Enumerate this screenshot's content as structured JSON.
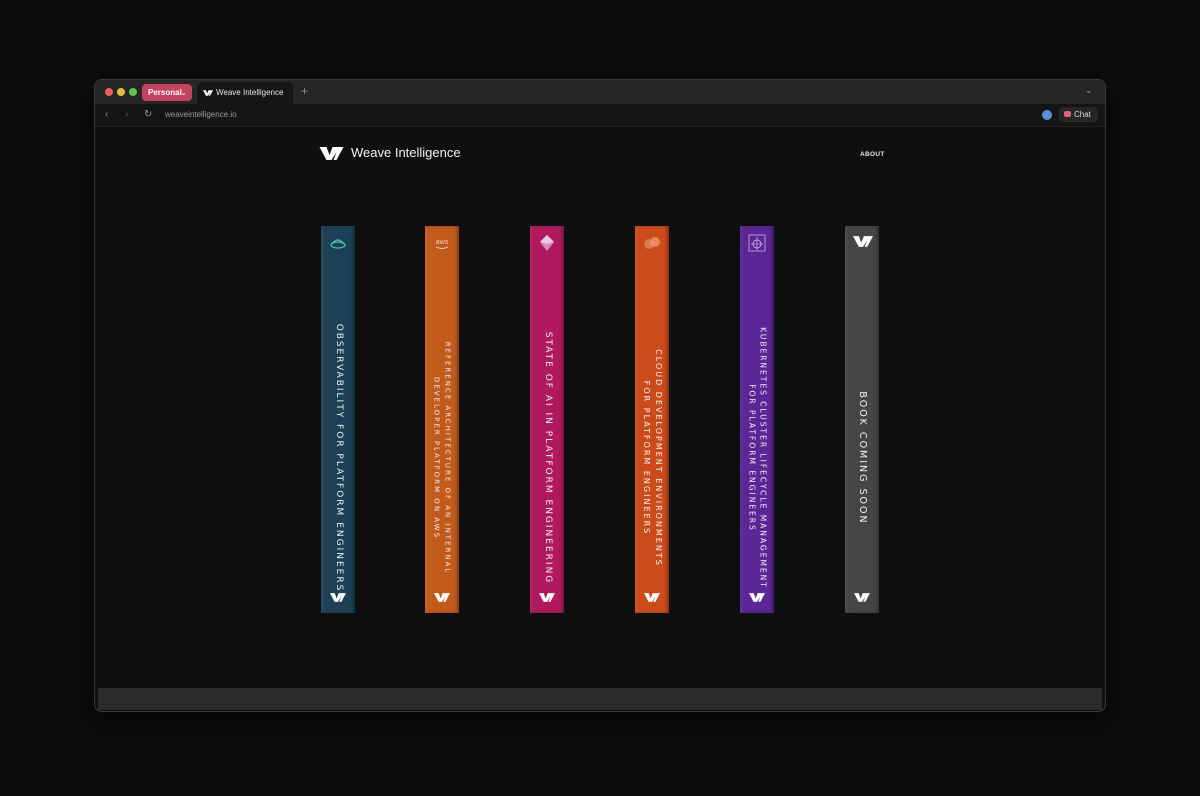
{
  "browser": {
    "profile_label": "Personal",
    "tab_title": "Weave Intelligence",
    "new_tab_symbol": "+",
    "url": "weaveintelligence.io",
    "chat_label": "Chat",
    "profile_color": "#c3425d"
  },
  "site": {
    "brand_name": "Weave Intelligence",
    "nav_about": "ABOUT"
  },
  "books": [
    {
      "title": "OBSERVABILITY FOR PLATFORM ENGINEERS",
      "lines": [
        "OBSERVABILITY FOR PLATFORM ENGINEERS"
      ],
      "color": "#1c4157",
      "icon": "bowl-icon"
    },
    {
      "title": "REFERENCE ARCHITECTURE OF AN INTERNAL DEVELOPER PLATFORM ON AWS",
      "lines": [
        "REFERENCE ARCHITECTURE OF AN INTERNAL",
        "DEVELOPER PLATFORM ON AWS"
      ],
      "color": "#c25a1c",
      "icon": "aws-icon"
    },
    {
      "title": "STATE OF AI IN PLATFORM ENGINEERING",
      "lines": [
        "STATE OF AI IN PLATFORM ENGINEERING"
      ],
      "color": "#b0195e",
      "icon": "crystal-icon"
    },
    {
      "title": "CLOUD DEVELOPMENT ENVIRONMENTS FOR PLATFORM ENGINEERS",
      "lines": [
        "CLOUD DEVELOPMENT ENVIRONMENTS",
        "FOR PLATFORM ENGINEERS"
      ],
      "color": "#cc4b1b",
      "icon": "cloud-icon"
    },
    {
      "title": "KUBERNETES CLUSTER LIFECYCLE MANAGEMENT FOR PLATFORM ENGINEERS",
      "lines": [
        "KUBERNETES CLUSTER LIFECYCLE MANAGEMENT",
        "FOR PLATFORM ENGINEERS"
      ],
      "color": "#5b2696",
      "icon": "helm-icon"
    },
    {
      "title": "BOOK COMING SOON",
      "lines": [
        "BOOK COMING SOON"
      ],
      "color": "#454545",
      "icon": "weave-logo-icon"
    }
  ]
}
